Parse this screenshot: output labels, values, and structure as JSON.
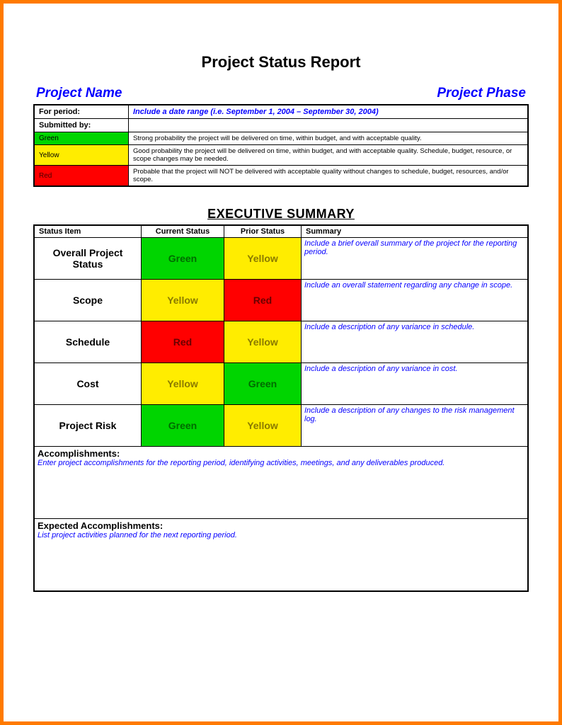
{
  "title": "Project Status Report",
  "header": {
    "left": "Project Name",
    "right": "Project Phase"
  },
  "info": {
    "period_label": "For period:",
    "period_value": "Include a date range (i.e. September 1, 2004 – September 30, 2004)",
    "submitted_label": "Submitted by:",
    "submitted_value": ""
  },
  "legend": [
    {
      "name": "Green",
      "class": "lg-green",
      "desc": "Strong probability the project will be delivered on time, within budget, and with acceptable quality."
    },
    {
      "name": "Yellow",
      "class": "lg-yellow",
      "desc": "Good probability the project will be delivered on time, within budget, and with acceptable quality. Schedule, budget, resource, or scope changes may be needed."
    },
    {
      "name": "Red",
      "class": "lg-red",
      "desc": "Probable that the project will NOT be delivered with acceptable quality without changes to schedule, budget, resources, and/or scope."
    }
  ],
  "exec_title": "EXECUTIVE SUMMARY",
  "exec_headers": {
    "c1": "Status Item",
    "c2": "Current Status",
    "c3": "Prior Status",
    "c4": "Summary"
  },
  "exec_rows": [
    {
      "item": "Overall Project Status",
      "current": "Green",
      "current_cls": "bg-green",
      "prior": "Yellow",
      "prior_cls": "bg-yellow",
      "summary": "Include a brief overall summary of the project for the reporting period."
    },
    {
      "item": "Scope",
      "current": "Yellow",
      "current_cls": "bg-yellow",
      "prior": "Red",
      "prior_cls": "bg-red",
      "summary": "Include an overall statement regarding any change in scope."
    },
    {
      "item": "Schedule",
      "current": "Red",
      "current_cls": "bg-red",
      "prior": "Yellow",
      "prior_cls": "bg-yellow",
      "summary": "Include a description of any variance in schedule."
    },
    {
      "item": "Cost",
      "current": "Yellow",
      "current_cls": "bg-yellow",
      "prior": "Green",
      "prior_cls": "bg-green",
      "summary": "Include a description of any variance in cost."
    },
    {
      "item": "Project Risk",
      "current": "Green",
      "current_cls": "bg-green",
      "prior": "Yellow",
      "prior_cls": "bg-yellow",
      "summary": "Include a description of any changes to the risk management log."
    }
  ],
  "accomplishments": {
    "label": "Accomplishments:",
    "text": "Enter project accomplishments for the reporting period, identifying activities, meetings, and any deliverables produced."
  },
  "expected": {
    "label": "Expected Accomplishments:",
    "text": "List project activities planned for the next reporting period."
  }
}
